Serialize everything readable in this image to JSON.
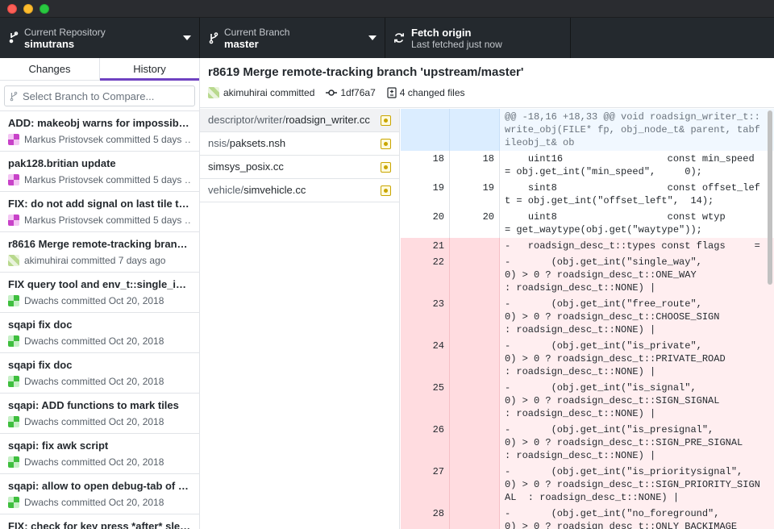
{
  "toolbar": {
    "repo_label": "Current Repository",
    "repo_value": "simutrans",
    "branch_label": "Current Branch",
    "branch_value": "master",
    "fetch_label": "Fetch origin",
    "fetch_sub": "Last fetched just now"
  },
  "sidebar": {
    "tabs": [
      "Changes",
      "History"
    ],
    "active_tab": "History",
    "compare_placeholder": "Select Branch to Compare...",
    "commits": [
      {
        "title": "ADD: makeobj warns for impossible …",
        "meta": "Markus Pristovsek committed 5 days …",
        "avatar": "markus"
      },
      {
        "title": "pak128.britian update",
        "meta": "Markus Pristovsek committed 5 days …",
        "avatar": "markus"
      },
      {
        "title": "FIX: do not add signal on last tile to …",
        "meta": "Markus Pristovsek committed 5 days …",
        "avatar": "markus"
      },
      {
        "title": "r8616 Merge remote-tracking branc…",
        "meta": "akimuhirai committed 7 days ago",
        "avatar": "aki"
      },
      {
        "title": "FIX query tool and env_t::single_info…",
        "meta": "Dwachs committed Oct 20, 2018",
        "avatar": "dw"
      },
      {
        "title": "sqapi fix doc",
        "meta": "Dwachs committed Oct 20, 2018",
        "avatar": "dw"
      },
      {
        "title": "sqapi fix doc",
        "meta": "Dwachs committed Oct 20, 2018",
        "avatar": "dw"
      },
      {
        "title": "sqapi: ADD functions to mark tiles",
        "meta": "Dwachs committed Oct 20, 2018",
        "avatar": "dw"
      },
      {
        "title": "sqapi: fix awk script",
        "meta": "Dwachs committed Oct 20, 2018",
        "avatar": "dw"
      },
      {
        "title": "sqapi: allow to open debug-tab of sc…",
        "meta": "Dwachs committed Oct 20, 2018",
        "avatar": "dw"
      },
      {
        "title": "FIX: check for key press *after* slee…",
        "meta": "",
        "avatar": "markus"
      }
    ]
  },
  "commit": {
    "title": "r8619 Merge remote-tracking branch 'upstream/master'",
    "author": "akimuhirai committed",
    "sha": "1df76a7",
    "changed": "4 changed files"
  },
  "files": [
    {
      "dir": "descriptor/writer/",
      "name": "roadsign_writer.cc",
      "status": "modified"
    },
    {
      "dir": "nsis/",
      "name": "paksets.nsh",
      "status": "modified"
    },
    {
      "dir": "",
      "name": "simsys_posix.cc",
      "status": "modified"
    },
    {
      "dir": "vehicle/",
      "name": "simvehicle.cc",
      "status": "modified"
    }
  ],
  "diff": [
    {
      "type": "hunk",
      "old": "",
      "new": "",
      "text": "@@ -18,16 +18,33 @@ void roadsign_writer_t::write_obj(FILE* fp, obj_node_t& parent, tabfileobj_t& ob"
    },
    {
      "type": "ctx",
      "old": "18",
      "new": "18",
      "text": "    uint16                  const min_speed   = obj.get_int(\"min_speed\",     0);"
    },
    {
      "type": "ctx",
      "old": "19",
      "new": "19",
      "text": "    sint8                   const offset_left = obj.get_int(\"offset_left\",  14);"
    },
    {
      "type": "ctx",
      "old": "20",
      "new": "20",
      "text": "    uint8                   const wtyp        = get_waytype(obj.get(\"waytype\"));"
    },
    {
      "type": "del",
      "old": "21",
      "new": "",
      "text": "-   roadsign_desc_t::types const flags     ="
    },
    {
      "type": "del",
      "old": "22",
      "new": "",
      "text": "-       (obj.get_int(\"single_way\",         0) > 0 ? roadsign_desc_t::ONE_WAY               : roadsign_desc_t::NONE) |"
    },
    {
      "type": "del",
      "old": "23",
      "new": "",
      "text": "-       (obj.get_int(\"free_route\",         0) > 0 ? roadsign_desc_t::CHOOSE_SIGN           : roadsign_desc_t::NONE) |"
    },
    {
      "type": "del",
      "old": "24",
      "new": "",
      "text": "-       (obj.get_int(\"is_private\",         0) > 0 ? roadsign_desc_t::PRIVATE_ROAD          : roadsign_desc_t::NONE) |"
    },
    {
      "type": "del",
      "old": "25",
      "new": "",
      "text": "-       (obj.get_int(\"is_signal\",          0) > 0 ? roadsign_desc_t::SIGN_SIGNAL           : roadsign_desc_t::NONE) |"
    },
    {
      "type": "del",
      "old": "26",
      "new": "",
      "text": "-       (obj.get_int(\"is_presignal\",       0) > 0 ? roadsign_desc_t::SIGN_PRE_SIGNAL       : roadsign_desc_t::NONE) |"
    },
    {
      "type": "del",
      "old": "27",
      "new": "",
      "text": "-       (obj.get_int(\"is_prioritysignal\",  0) > 0 ? roadsign_desc_t::SIGN_PRIORITY_SIGNAL  : roadsign_desc_t::NONE) |"
    },
    {
      "type": "del",
      "old": "28",
      "new": "",
      "text": "-       (obj.get_int(\"no_foreground\",      0) > 0 ? roadsign_desc_t::ONLY_BACKIMAGE"
    }
  ]
}
